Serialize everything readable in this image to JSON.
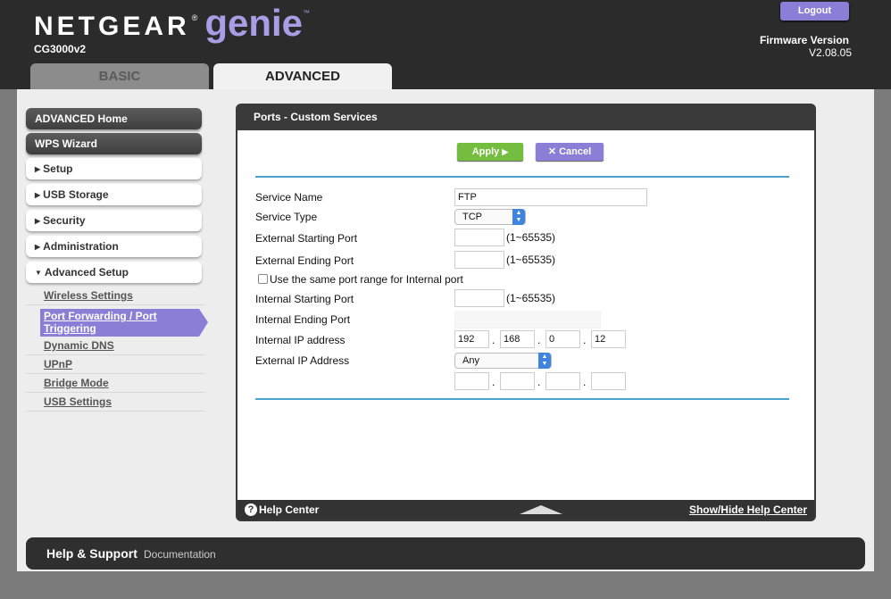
{
  "header": {
    "brand_netgear": "NETGEAR",
    "brand_reg": "®",
    "brand_genie": "genie",
    "brand_tm": "™",
    "model": "CG3000v2",
    "logout": "Logout",
    "firmware_label": "Firmware Version",
    "firmware_value": "V2.08.05",
    "tabs": [
      {
        "label": "BASIC",
        "selected": false
      },
      {
        "label": "ADVANCED",
        "selected": true
      }
    ]
  },
  "sidebar": {
    "advanced_home": "ADVANCED Home",
    "wps_wizard": "WPS Wizard",
    "sections": [
      {
        "label": "Setup",
        "expanded": false
      },
      {
        "label": "USB Storage",
        "expanded": false
      },
      {
        "label": "Security",
        "expanded": false
      },
      {
        "label": "Administration",
        "expanded": false
      },
      {
        "label": "Advanced Setup",
        "expanded": true
      }
    ],
    "sublinks": [
      {
        "label": "Wireless Settings"
      },
      {
        "label": "Port Forwarding / Port Triggering",
        "active": true
      },
      {
        "label": "Dynamic DNS"
      },
      {
        "label": "UPnP"
      },
      {
        "label": "Bridge Mode"
      },
      {
        "label": "USB Settings"
      }
    ]
  },
  "panel": {
    "title": "Ports - Custom Services",
    "apply": "Apply",
    "apply_icon": "▶",
    "cancel": "Cancel",
    "cancel_icon": "✕"
  },
  "form": {
    "service_name_label": "Service Name",
    "service_name_value": "FTP",
    "service_type_label": "Service Type",
    "service_type_value": "TCP",
    "ext_start_label": "External Starting Port",
    "ext_start_value": "",
    "ext_start_hint": "(1~65535)",
    "ext_end_label": "External Ending Port",
    "ext_end_value": "",
    "ext_end_hint": "(1~65535)",
    "same_range_label": "Use the same port range for Internal port",
    "same_range_checked": false,
    "int_start_label": "Internal Starting Port",
    "int_start_value": "",
    "int_start_hint": "(1~65535)",
    "int_end_label": "Internal Ending Port",
    "int_end_value": "",
    "int_ip_label": "Internal IP address",
    "int_ip": [
      "192",
      "168",
      "0",
      "12"
    ],
    "ext_ip_label": "External IP Address",
    "ext_ip_select": "Any",
    "ext_ip": [
      "",
      "",
      "",
      ""
    ],
    "dot": "."
  },
  "help": {
    "icon": "?",
    "center": "Help Center",
    "toggle": "Show/Hide Help Center"
  },
  "footer": {
    "title": "Help & Support",
    "doc": "Documentation"
  },
  "colors": {
    "accent": "#8a7ed6",
    "apply_green": "#74bd3e",
    "rule_blue": "#4aa3c9"
  }
}
